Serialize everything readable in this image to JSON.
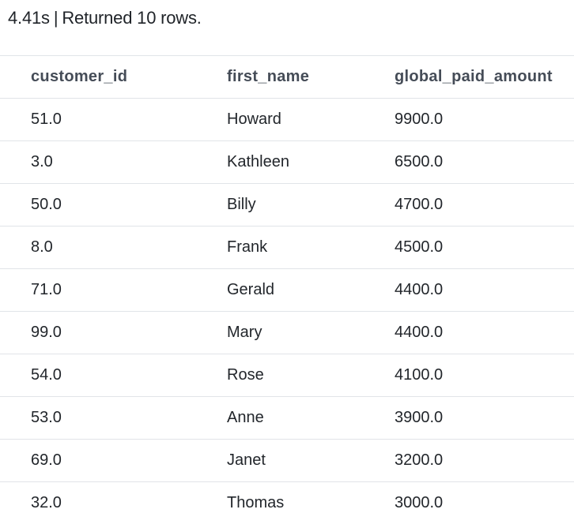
{
  "status": {
    "duration": "4.41s",
    "separator": "|",
    "message": "Returned 10 rows."
  },
  "table": {
    "columns": [
      "customer_id",
      "first_name",
      "global_paid_amount"
    ],
    "rows": [
      [
        "51.0",
        "Howard",
        "9900.0"
      ],
      [
        "3.0",
        "Kathleen",
        "6500.0"
      ],
      [
        "50.0",
        "Billy",
        "4700.0"
      ],
      [
        "8.0",
        "Frank",
        "4500.0"
      ],
      [
        "71.0",
        "Gerald",
        "4400.0"
      ],
      [
        "99.0",
        "Mary",
        "4400.0"
      ],
      [
        "54.0",
        "Rose",
        "4100.0"
      ],
      [
        "53.0",
        "Anne",
        "3900.0"
      ],
      [
        "69.0",
        "Janet",
        "3200.0"
      ],
      [
        "32.0",
        "Thomas",
        "3000.0"
      ]
    ]
  }
}
